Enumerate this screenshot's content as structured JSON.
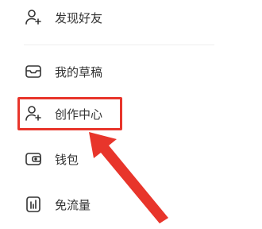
{
  "menu": {
    "items": [
      {
        "label": "发现好友",
        "icon": "add-friend-icon"
      },
      {
        "label": "我的草稿",
        "icon": "drafts-icon"
      },
      {
        "label": "创作中心",
        "icon": "creator-center-icon"
      },
      {
        "label": "钱包",
        "icon": "wallet-icon"
      },
      {
        "label": "免流量",
        "icon": "data-free-icon"
      }
    ]
  },
  "annotation": {
    "highlight_color": "#e8352b",
    "target": "创作中心"
  }
}
